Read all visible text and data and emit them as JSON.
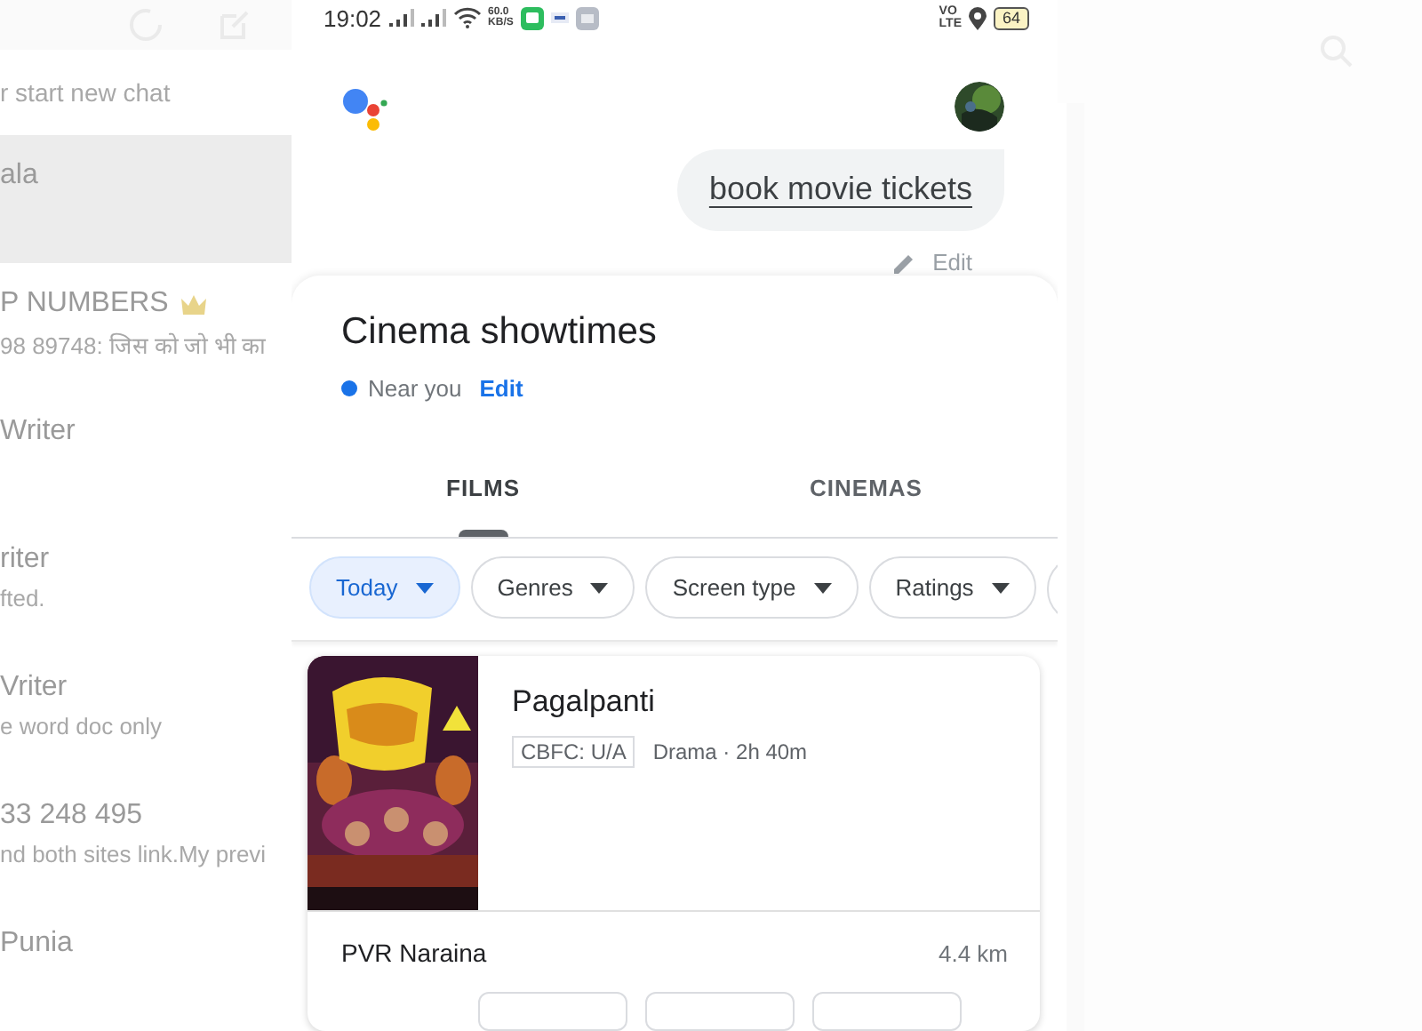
{
  "background_chats": {
    "hint": "r start new chat",
    "items": [
      {
        "title": "ala",
        "selected": true
      },
      {
        "title": "P NUMBERS",
        "preview": "98 89748: जिस को जो भी का",
        "crowned": true,
        "selected": false
      },
      {
        "title": "Writer",
        "selected": false
      },
      {
        "title": "riter",
        "preview": "fted.",
        "selected": false
      },
      {
        "title": "Vriter",
        "preview": "e word doc only",
        "selected": false
      },
      {
        "title": "33 248 495",
        "preview": "nd both sites link.My previ",
        "selected": false
      },
      {
        "title": "Punia",
        "selected": false
      }
    ]
  },
  "status_bar": {
    "time": "19:02",
    "net_speed": "60.0",
    "net_unit": "KB/S",
    "volte_top": "VO",
    "volte_bottom": "LTE",
    "battery": "64"
  },
  "query": {
    "text": "book movie tickets",
    "edit": "Edit"
  },
  "card": {
    "title": "Cinema showtimes",
    "location": "Near you",
    "location_action": "Edit",
    "tabs": [
      {
        "label": "FILMS",
        "selected": true
      },
      {
        "label": "CINEMAS",
        "selected": false
      }
    ],
    "filters": [
      {
        "label": "Today",
        "selected": true
      },
      {
        "label": "Genres",
        "selected": false
      },
      {
        "label": "Screen type",
        "selected": false
      },
      {
        "label": "Ratings",
        "selected": false
      }
    ]
  },
  "movie": {
    "title": "Pagalpanti",
    "certificate": "CBFC: U/A",
    "meta": "Drama · 2h 40m",
    "cinema": "PVR Naraina",
    "distance": "4.4 km"
  }
}
